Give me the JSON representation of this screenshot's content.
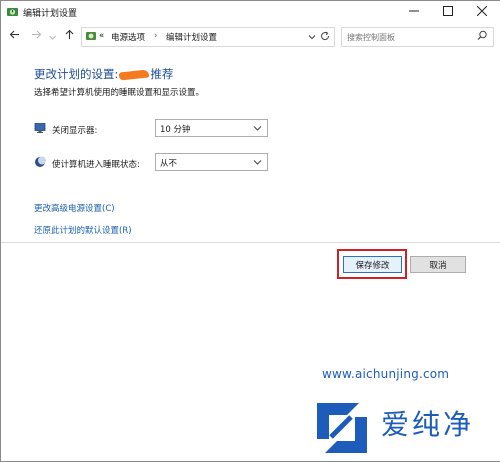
{
  "window": {
    "title": "编辑计划设置",
    "icon": "power-plan-icon"
  },
  "nav": {
    "back_icon": "arrow-left-icon",
    "forward_icon": "arrow-right-icon",
    "up_icon": "arrow-up-icon",
    "breadcrumb": {
      "overflow": "«",
      "items": [
        "电源选项",
        "编辑计划设置"
      ]
    },
    "search_placeholder": "搜索控制面板"
  },
  "content": {
    "heading_prefix": "更改计划的设置:",
    "heading_suffix": "推荐",
    "subtitle": "选择希望计算机使用的睡眠设置和显示设置。",
    "settings": [
      {
        "label": "关闭显示器:",
        "icon": "monitor-icon",
        "value": "10 分钟"
      },
      {
        "label": "使计算机进入睡眠状态:",
        "icon": "moon-icon",
        "value": "从不"
      }
    ],
    "links": {
      "advanced": "更改高级电源设置(C)",
      "restore": "还原此计划的默认设置(R)"
    }
  },
  "buttons": {
    "save": "保存修改",
    "cancel": "取消"
  },
  "highlight_color": "#d01f26",
  "watermark": {
    "url": "www.aichunjing.com",
    "brand": "爱纯净"
  }
}
